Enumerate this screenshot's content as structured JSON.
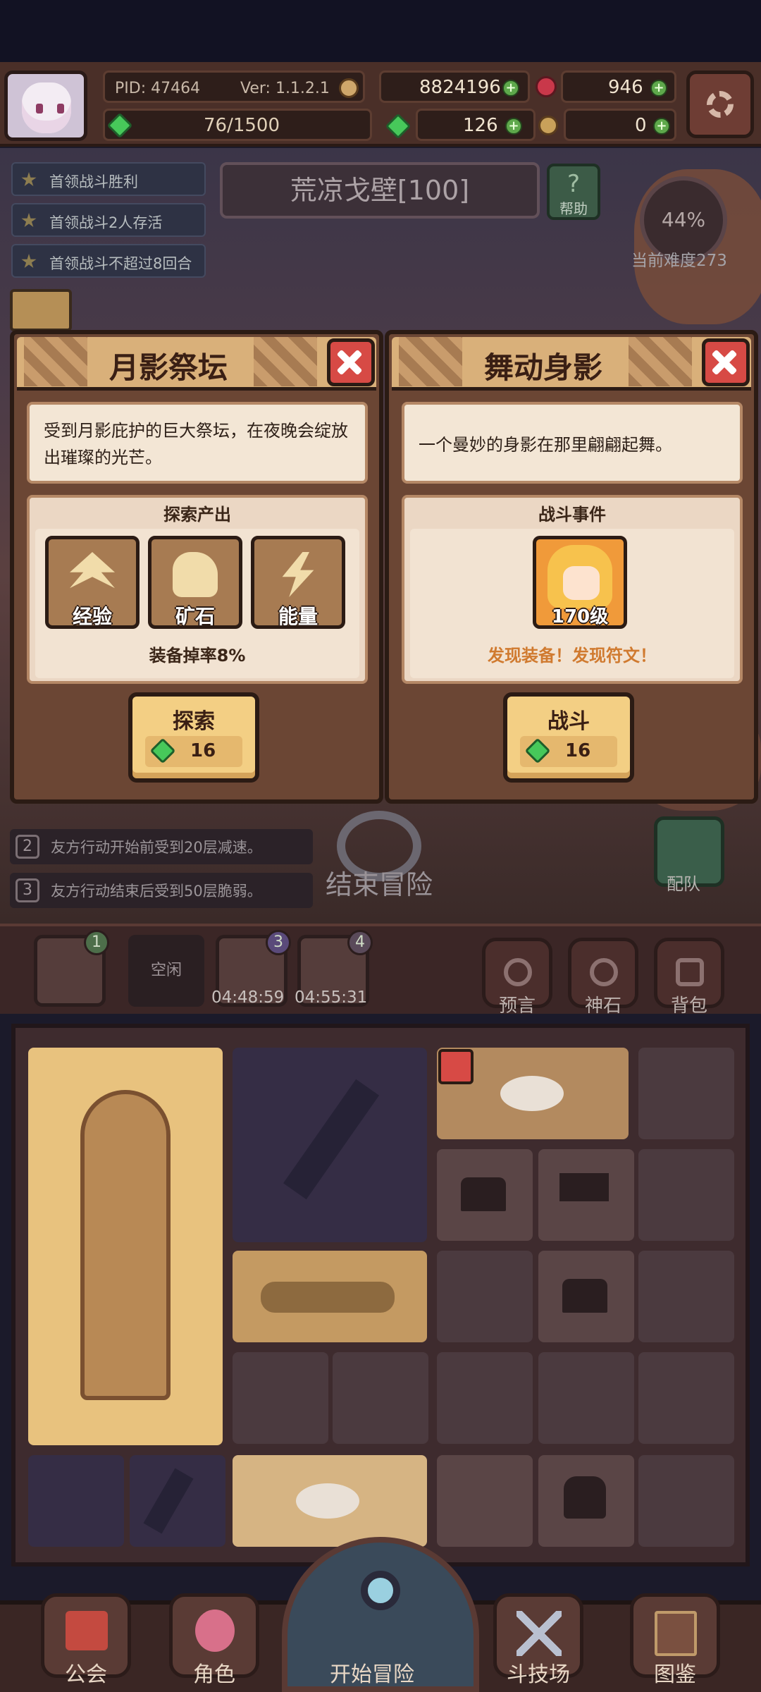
{
  "hud": {
    "pid": "PID: 47464",
    "version": "Ver: 1.1.2.1",
    "gold": "8824196",
    "ruby": "946",
    "stamina": "76/1500",
    "clover": "126",
    "ticket": "0"
  },
  "quests": [
    "首领战斗胜利",
    "首领战斗2人存活",
    "首领战斗不超过8回合"
  ],
  "stage": {
    "title": "荒凉戈壁[100]",
    "help_label": "帮助",
    "difficulty_pct": "44%",
    "difficulty_label": "当前难度273"
  },
  "dialog_left": {
    "title": "月影祭坛",
    "desc": "受到月影庇护的巨大祭坛，在夜晚会绽放出璀璨的光芒。",
    "section_title": "探索产出",
    "items": [
      "经验",
      "矿石",
      "能量"
    ],
    "drop_rate": "装备掉率8%",
    "button_label": "探索",
    "button_cost": "16"
  },
  "dialog_right": {
    "title": "舞动身影",
    "desc": "一个曼妙的身影在那里翩翩起舞。",
    "section_title": "战斗事件",
    "enemy_level": "170级",
    "found_text": "发现装备！发现符文！",
    "button_label": "战斗",
    "button_cost": "16"
  },
  "buffs": [
    {
      "num": "2",
      "text": "友方行动开始前受到20层减速。"
    },
    {
      "num": "3",
      "text": "友方行动结束后受到50层脆弱。"
    }
  ],
  "end_adventure": "结束冒险",
  "team_label": "配队",
  "slots": {
    "badge1": "1",
    "idle": "空闲",
    "badge3": "3",
    "badge4": "4",
    "time3": "04:48:59",
    "time4": "04:55:31"
  },
  "tools": [
    "预言",
    "神石",
    "背包"
  ],
  "nav": {
    "guild": "公会",
    "character": "角色",
    "start": "开始冒险",
    "arena": "斗技场",
    "codex": "图鉴"
  },
  "colors": {
    "dialog_header": "#d9b07a",
    "close_red": "#d74a45",
    "gem_green": "#47c85a",
    "found_orange": "#d07a2f"
  }
}
